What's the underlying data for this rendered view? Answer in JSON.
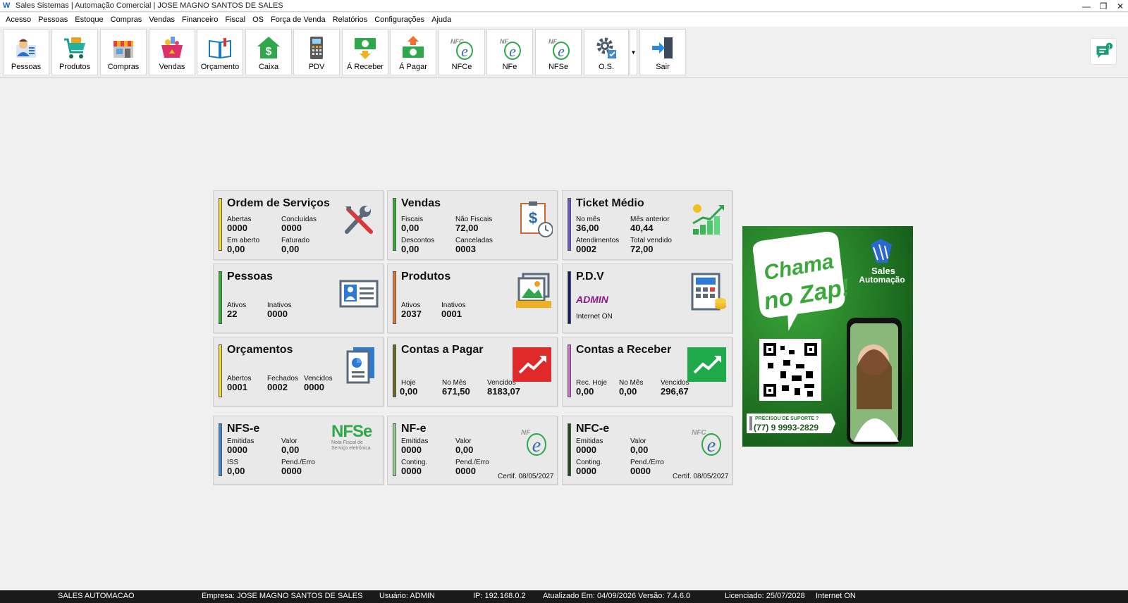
{
  "window": {
    "title": "Sales Sistemas | Automação Comercial | JOSE MAGNO SANTOS DE SALES",
    "min": "—",
    "max": "❐",
    "close": "✕"
  },
  "menu": [
    "Acesso",
    "Pessoas",
    "Estoque",
    "Compras",
    "Vendas",
    "Financeiro",
    "Fiscal",
    "OS",
    "Força de Venda",
    "Relatórios",
    "Configurações",
    "Ajuda"
  ],
  "toolbar": [
    {
      "label": "Pessoas",
      "icon": "person-icon"
    },
    {
      "label": "Produtos",
      "icon": "cart-icon"
    },
    {
      "label": "Compras",
      "icon": "store-icon"
    },
    {
      "label": "Vendas",
      "icon": "basket-icon"
    },
    {
      "label": "Orçamento",
      "icon": "book-icon"
    },
    {
      "label": "Caixa",
      "icon": "cash-house-icon"
    },
    {
      "label": "PDV",
      "icon": "pos-terminal-icon"
    },
    {
      "label": "Á Receber",
      "icon": "money-in-icon"
    },
    {
      "label": "Á Pagar",
      "icon": "money-out-icon"
    },
    {
      "label": "NFCe",
      "icon": "nfce-icon"
    },
    {
      "label": "NFe",
      "icon": "nfe-icon"
    },
    {
      "label": "NFSe",
      "icon": "nfse-icon"
    },
    {
      "label": "O.S.",
      "icon": "gear-icon"
    },
    {
      "label": "Sair",
      "icon": "exit-icon"
    }
  ],
  "chat_badge": "1",
  "cards": {
    "os": {
      "title": "Ordem de Serviços",
      "color": "#f5e51c",
      "l1": "Abertas",
      "v1": "0000",
      "l2": "Concluídas",
      "v2": "0000",
      "l3": "Em aberto",
      "v3": "0,00",
      "l4": "Faturado",
      "v4": "0,00"
    },
    "vendas": {
      "title": "Vendas",
      "color": "#2db52d",
      "l1": "Fiscais",
      "v1": "0,00",
      "l2": "Não Fiscais",
      "v2": "72,00",
      "l3": "Descontos",
      "v3": "0,00",
      "l4": "Canceladas",
      "v4": "0003"
    },
    "ticket": {
      "title": "Ticket Médio",
      "color": "#6a5bc7",
      "l1": "No mês",
      "v1": "36,00",
      "l2": "Mês anterior",
      "v2": "40,44",
      "l3": "Atendimentos",
      "v3": "0002",
      "l4": "Total vendido",
      "v4": "72,00"
    },
    "pessoas": {
      "title": "Pessoas",
      "color": "#2db52d",
      "l1": "Ativos",
      "v1": "22",
      "l2": "Inativos",
      "v2": "0000"
    },
    "produtos": {
      "title": "Produtos",
      "color": "#e8782a",
      "l1": "Ativos",
      "v1": "2037",
      "l2": "Inativos",
      "v2": "0001"
    },
    "pdv": {
      "title": "P.D.V",
      "color": "#1a1a6e",
      "user": "ADMIN",
      "status": "Internet ON"
    },
    "orcamentos": {
      "title": "Orçamentos",
      "color": "#f5e51c",
      "l1": "Abertos",
      "v1": "0001",
      "l2": "Fechados",
      "v2": "0002",
      "l3": "Vencidos",
      "v3": "0000"
    },
    "pagar": {
      "title": "Contas a Pagar",
      "color": "#6b6b1a",
      "l1": "Hoje",
      "v1": "0,00",
      "l2": "No Mês",
      "v2": "671,50",
      "l3": "Vencidos",
      "v3": "8183,07"
    },
    "receber": {
      "title": "Contas a Receber",
      "color": "#d66ad6",
      "l1": "Rec. Hoje",
      "v1": "0,00",
      "l2": "No Mês",
      "v2": "0,00",
      "l3": "Vencidos",
      "v3": "296,67"
    },
    "nfse": {
      "title": "NFS-e",
      "color": "#3a8ad6",
      "l1": "Emitidas",
      "v1": "0000",
      "l2": "Valor",
      "v2": "0,00",
      "l3": "ISS",
      "v3": "0,00",
      "l4": "Pend./Erro",
      "v4": "0000",
      "logo": "NFSe",
      "logo_sub1": "Nota Fiscal de",
      "logo_sub2": "Serviço eletrônica"
    },
    "nfe": {
      "title": "NF-e",
      "color": "#8fd68f",
      "l1": "Emitidas",
      "v1": "0000",
      "l2": "Valor",
      "v2": "0,00",
      "l3": "Conting.",
      "v3": "0000",
      "l4": "Pend./Erro",
      "v4": "0000",
      "cert": "Certif. 08/05/2027"
    },
    "nfce": {
      "title": "NFC-e",
      "color": "#1a4d1a",
      "l1": "Emitidas",
      "v1": "0000",
      "l2": "Valor",
      "v2": "0,00",
      "l3": "Conting.",
      "v3": "0000",
      "l4": "Pend./Erro",
      "v4": "0000",
      "cert": "Certif. 08/05/2027"
    }
  },
  "ad": {
    "line1": "Chama",
    "line2": "no Zap!",
    "brand1": "Sales",
    "brand2": "Automação",
    "support": "PRECISOU DE SUPORTE ?",
    "phone": "(77) 9 9993-2829"
  },
  "status": {
    "app": "SALES AUTOMACAO",
    "empresa": "Empresa: JOSE MAGNO SANTOS DE SALES",
    "usuario": "Usuário: ADMIN",
    "ip": "IP: 192.168.0.2",
    "atualizado": "Atualizado Em: 04/09/2026  Versão: 7.4.6.0",
    "licenciado": "Licenciado: 25/07/2028",
    "internet": "Internet ON"
  }
}
